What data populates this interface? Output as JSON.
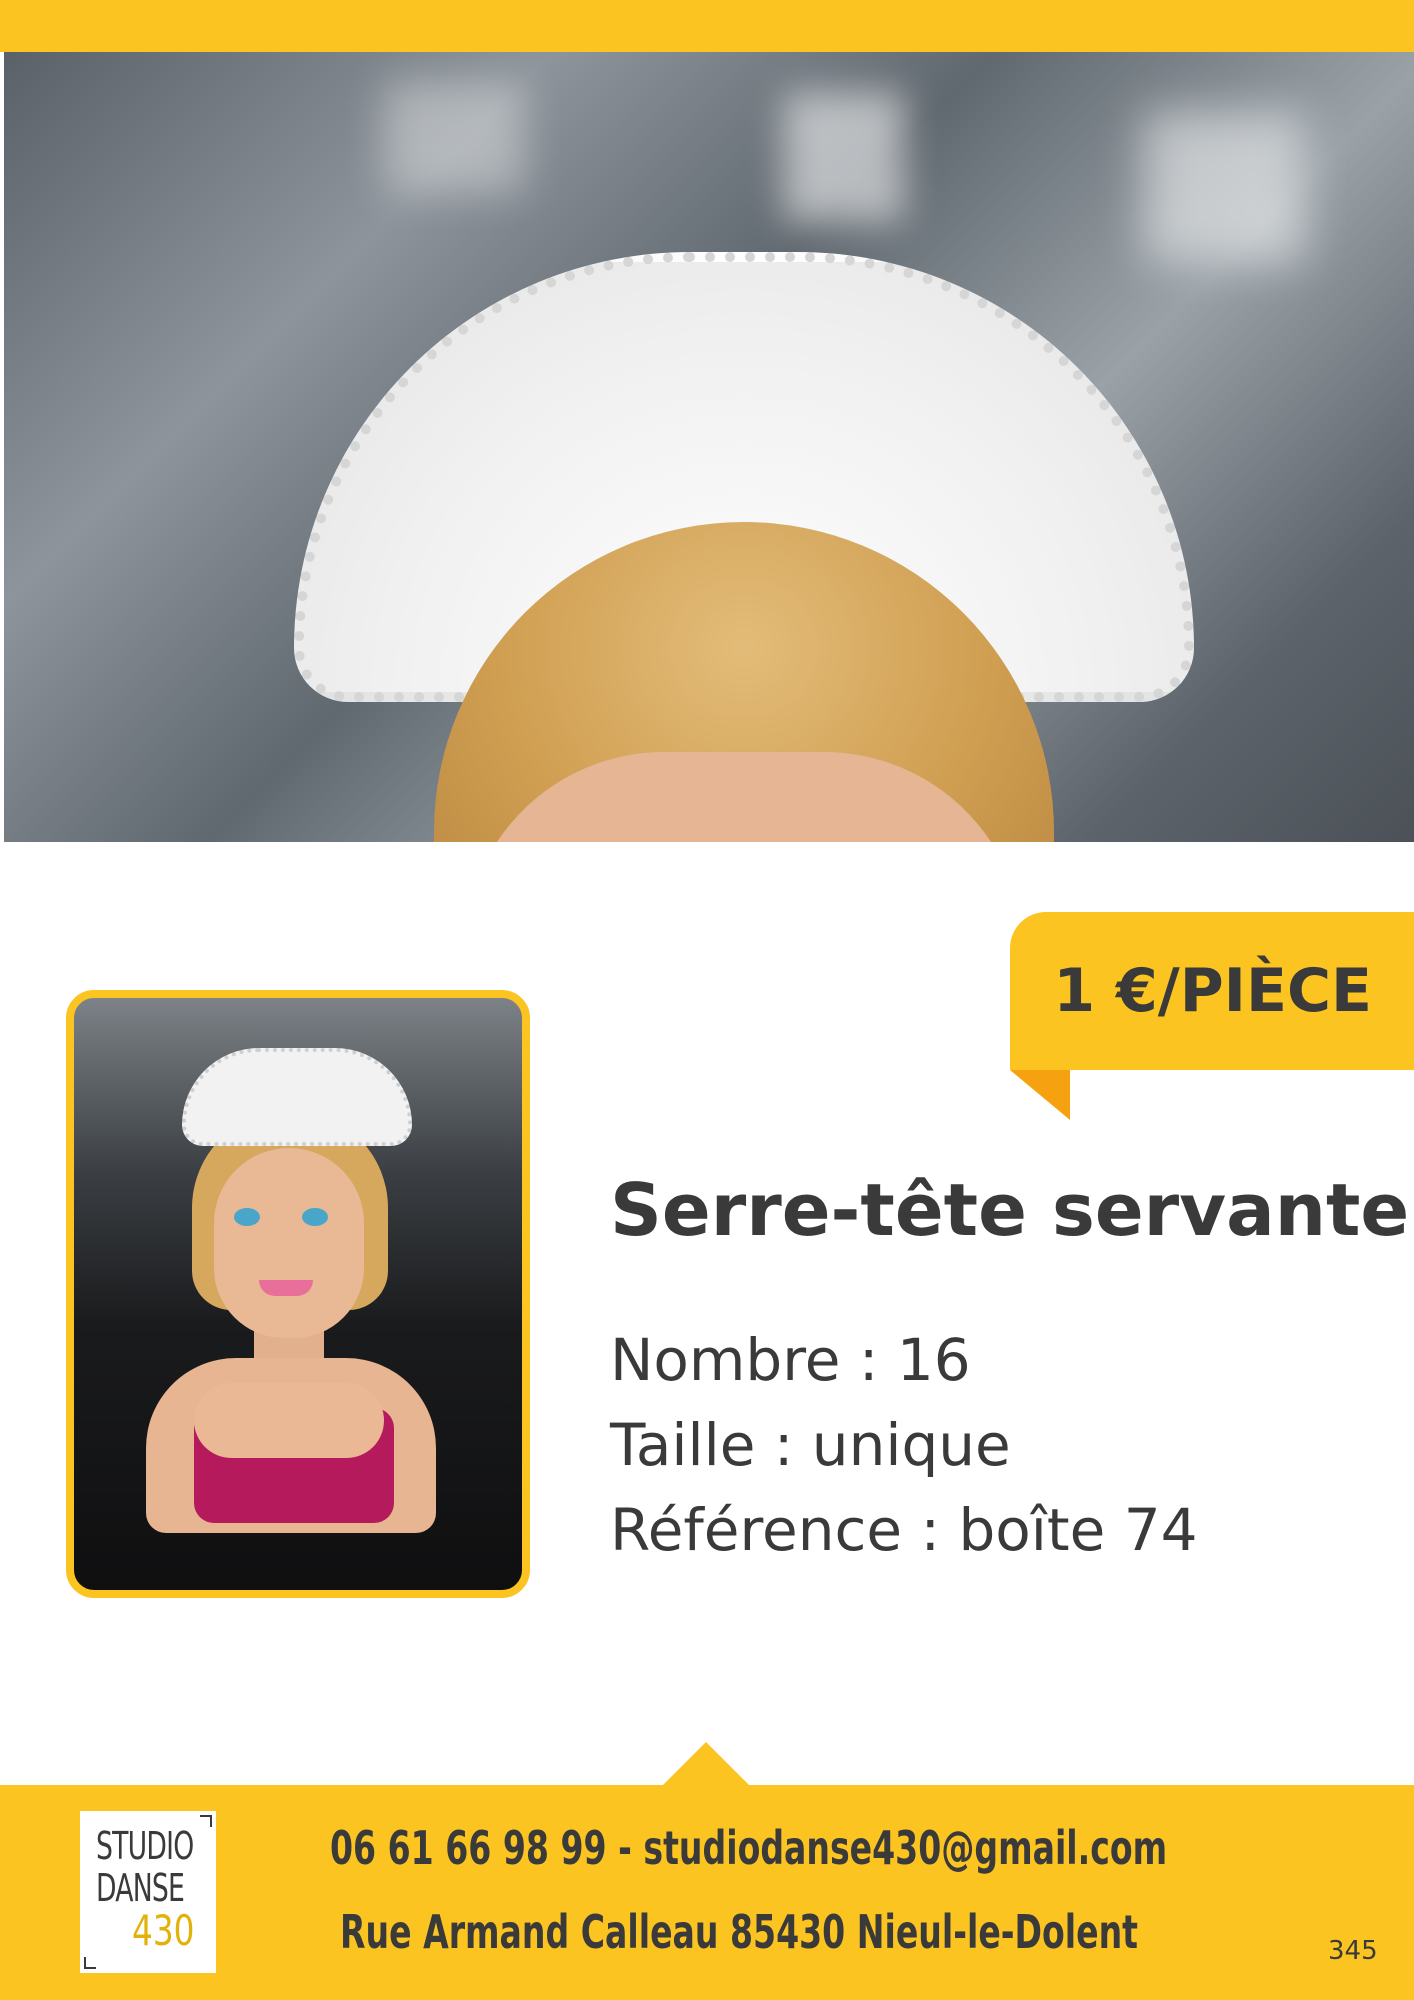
{
  "price_badge": {
    "label": "1 €/PIÈCE"
  },
  "product": {
    "title": "Serre-tête servante",
    "details": [
      "Nombre : 16",
      "Taille : unique",
      "Référence : boîte 74"
    ]
  },
  "footer": {
    "logo": {
      "line1": "STUDIO",
      "line2": "DANSE",
      "line3": "430"
    },
    "contact": "06 61 66 98 99 - studiodanse430@gmail.com",
    "address": "Rue Armand Calleau 85430 Nieul-le-Dolent",
    "page_number": "345"
  },
  "colors": {
    "accent": "#fcc421",
    "accent_dark": "#f6a10f",
    "text": "#3a3a3a"
  }
}
